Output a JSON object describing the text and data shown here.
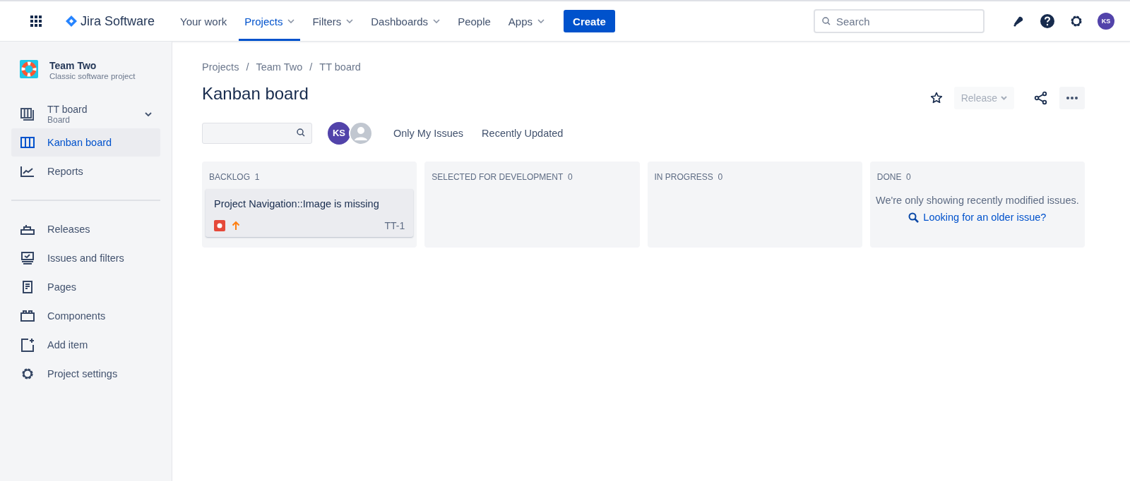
{
  "topbar": {
    "product": "Jira Software",
    "nav": [
      {
        "label": "Your work",
        "selected": false,
        "dropdown": false
      },
      {
        "label": "Projects",
        "selected": true,
        "dropdown": true
      },
      {
        "label": "Filters",
        "selected": false,
        "dropdown": true
      },
      {
        "label": "Dashboards",
        "selected": false,
        "dropdown": true
      },
      {
        "label": "People",
        "selected": false,
        "dropdown": false
      },
      {
        "label": "Apps",
        "selected": false,
        "dropdown": true
      }
    ],
    "create": "Create",
    "search": {
      "placeholder": "Search"
    },
    "avatar": "KS"
  },
  "sidebar": {
    "project": {
      "name": "Team Two",
      "type": "Classic software project"
    },
    "board": {
      "name": "TT board",
      "sub": "Board",
      "expanded": true
    },
    "items": [
      {
        "label": "Kanban board",
        "kind": "board",
        "selected": true
      },
      {
        "label": "Reports",
        "kind": "reports",
        "selected": false
      }
    ],
    "items2": [
      {
        "label": "Releases",
        "kind": "releases",
        "selected": false
      },
      {
        "label": "Issues and filters",
        "kind": "issues",
        "selected": false
      },
      {
        "label": "Pages",
        "kind": "pages",
        "selected": false
      },
      {
        "label": "Components",
        "kind": "components",
        "selected": false
      },
      {
        "label": "Add item",
        "kind": "add",
        "selected": false
      },
      {
        "label": "Project settings",
        "kind": "settings",
        "selected": false
      }
    ]
  },
  "breadcrumbs": {
    "separator": "/",
    "items": [
      "Projects",
      "Team Two",
      "TT board"
    ]
  },
  "title": "Kanban board",
  "release": {
    "label": "Release",
    "disabled": true
  },
  "filters": {
    "avatar": "KS",
    "quick": [
      "Only My Issues",
      "Recently Updated"
    ]
  },
  "columns": [
    {
      "name": "BACKLOG",
      "count": "1",
      "cards": [
        {
          "summary": "Project Navigation::Image is missing",
          "key": "TT-1"
        }
      ]
    },
    {
      "name": "SELECTED FOR DEVELOPMENT",
      "count": "0"
    },
    {
      "name": "IN PROGRESS",
      "count": "0"
    },
    {
      "name": "DONE",
      "count": "0",
      "message": "We're only showing recently modified issues.",
      "link": "Looking for an older issue?"
    }
  ]
}
